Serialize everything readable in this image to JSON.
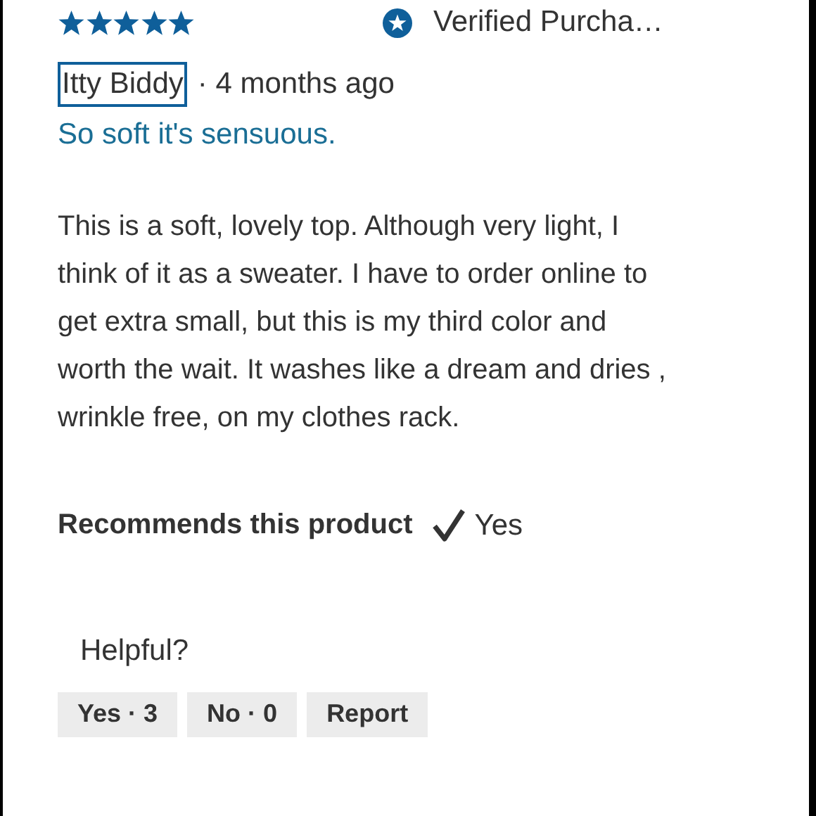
{
  "review": {
    "stars": 5,
    "verified_label": "Verified Purcha…",
    "author": "Itty Biddy",
    "age": "· 4 months ago",
    "title": "So soft it's sensuous.",
    "body": "This is a soft, lovely top. Although very light, I think of it as a sweater. I have to order online to get extra small, but this is my third color and worth the wait. It washes like a dream and dries , wrinkle free, on my clothes rack.",
    "recommends_label": "Recommends this product",
    "recommends": true,
    "recommends_value": "Yes"
  },
  "helpful": {
    "prompt": "Helpful?",
    "buttons": [
      {
        "label": "Yes · 3"
      },
      {
        "label": "No · 0"
      },
      {
        "label": "Report"
      }
    ]
  }
}
